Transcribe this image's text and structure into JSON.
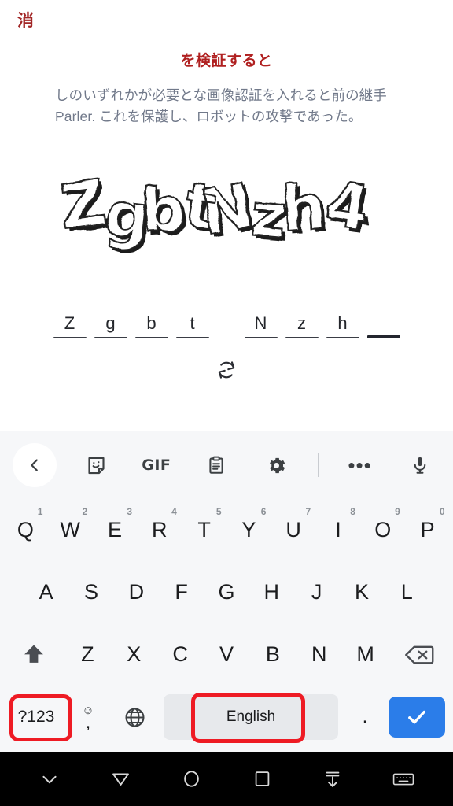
{
  "page": {
    "dismiss_label": "消",
    "heading": "を検証すると",
    "body": "しのいずれかが必要とな画像認証を入れると前の継手Parler. これを保護し、ロボットの攻撃であった。",
    "captcha_text": "ZgbtNzh4",
    "refresh_icon": "refresh-icon",
    "colors": {
      "heading": "#b02020",
      "dismiss": "#a22626",
      "body": "#71798a",
      "accent_blue": "#2b7de9",
      "annotation_red": "#ee1b24"
    }
  },
  "answer_slots": [
    {
      "value": "Z",
      "active": false
    },
    {
      "value": "g",
      "active": false
    },
    {
      "value": "b",
      "active": false
    },
    {
      "value": "t",
      "active": false
    },
    {
      "value": "N",
      "active": false
    },
    {
      "value": "z",
      "active": false
    },
    {
      "value": "h",
      "active": false
    },
    {
      "value": "",
      "active": true
    }
  ],
  "keyboard": {
    "toolbar": [
      {
        "name": "back-chevron-icon",
        "label": ""
      },
      {
        "name": "sticker-icon",
        "label": ""
      },
      {
        "name": "gif-icon",
        "label": "GIF"
      },
      {
        "name": "clipboard-icon",
        "label": ""
      },
      {
        "name": "gear-icon",
        "label": ""
      },
      {
        "name": "overflow-dots-icon",
        "label": "•••"
      },
      {
        "name": "microphone-icon",
        "label": ""
      }
    ],
    "row1": [
      {
        "key": "Q",
        "sup": "1"
      },
      {
        "key": "W",
        "sup": "2"
      },
      {
        "key": "E",
        "sup": "3"
      },
      {
        "key": "R",
        "sup": "4"
      },
      {
        "key": "T",
        "sup": "5"
      },
      {
        "key": "Y",
        "sup": "6"
      },
      {
        "key": "U",
        "sup": "7"
      },
      {
        "key": "I",
        "sup": "8"
      },
      {
        "key": "O",
        "sup": "9"
      },
      {
        "key": "P",
        "sup": "0"
      }
    ],
    "row2": [
      "A",
      "S",
      "D",
      "F",
      "G",
      "H",
      "J",
      "K",
      "L"
    ],
    "row3": [
      "Z",
      "X",
      "C",
      "V",
      "B",
      "N",
      "M"
    ],
    "row3_shift_icon": "shift-arrow-icon",
    "row3_backspace_icon": "backspace-icon",
    "row4": {
      "symbols_label": "?123",
      "emoji_label": "☺",
      "comma_label": ",",
      "globe_icon": "globe-icon",
      "space_label": "English",
      "period_label": ".",
      "enter_icon": "check-icon"
    }
  },
  "navbar": [
    {
      "name": "hide-keyboard-icon"
    },
    {
      "name": "back-triangle-icon"
    },
    {
      "name": "home-circle-icon"
    },
    {
      "name": "recents-square-icon"
    },
    {
      "name": "scroll-down-icon"
    },
    {
      "name": "keyboard-icon"
    }
  ]
}
